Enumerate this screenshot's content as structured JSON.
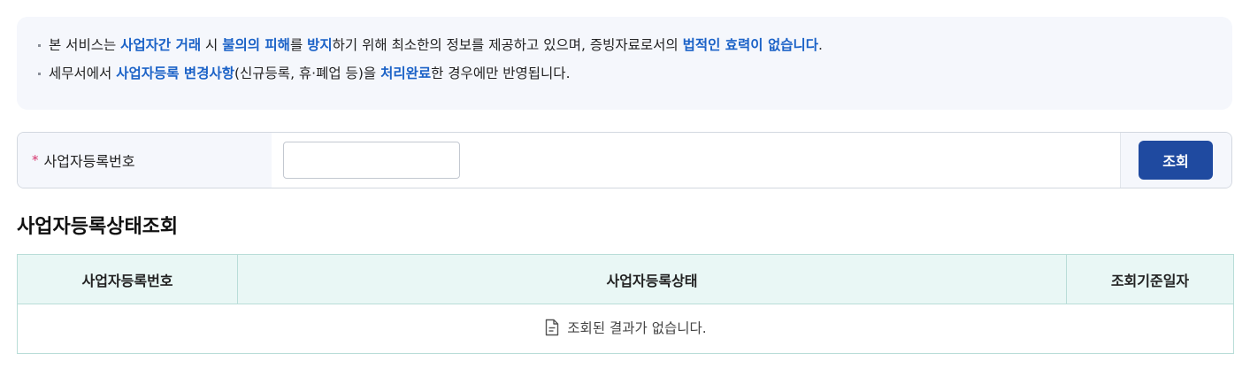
{
  "notice": {
    "line1": [
      {
        "t": "본 서비스는 ",
        "hl": false
      },
      {
        "t": "사업자간 거래",
        "hl": true
      },
      {
        "t": " 시 ",
        "hl": false
      },
      {
        "t": "불의의 피해",
        "hl": true
      },
      {
        "t": "를 ",
        "hl": false
      },
      {
        "t": "방지",
        "hl": true
      },
      {
        "t": "하기 위해 최소한의 정보를 제공하고 있으며, 증빙자료로서의 ",
        "hl": false
      },
      {
        "t": "법적인 효력이 없습니다",
        "hl": true
      },
      {
        "t": ".",
        "hl": false
      }
    ],
    "line2": [
      {
        "t": "세무서에서 ",
        "hl": false
      },
      {
        "t": "사업자등록 변경사항",
        "hl": true
      },
      {
        "t": "(신규등록, 휴·폐업 등)을 ",
        "hl": false
      },
      {
        "t": "처리완료",
        "hl": true
      },
      {
        "t": "한 경우에만 반영됩니다.",
        "hl": false
      }
    ]
  },
  "search": {
    "required_mark": "*",
    "label": "사업자등록번호",
    "value": "",
    "placeholder": "",
    "button_label": "조회"
  },
  "section_title": "사업자등록상태조회",
  "table": {
    "headers": [
      "사업자등록번호",
      "사업자등록상태",
      "조회기준일자"
    ],
    "empty_message": "조회된 결과가 없습니다."
  },
  "colors": {
    "accent_text": "#1b62c7",
    "button_bg": "#1f4aa0",
    "header_bg": "#e9f7f5",
    "required": "#d6336c"
  }
}
